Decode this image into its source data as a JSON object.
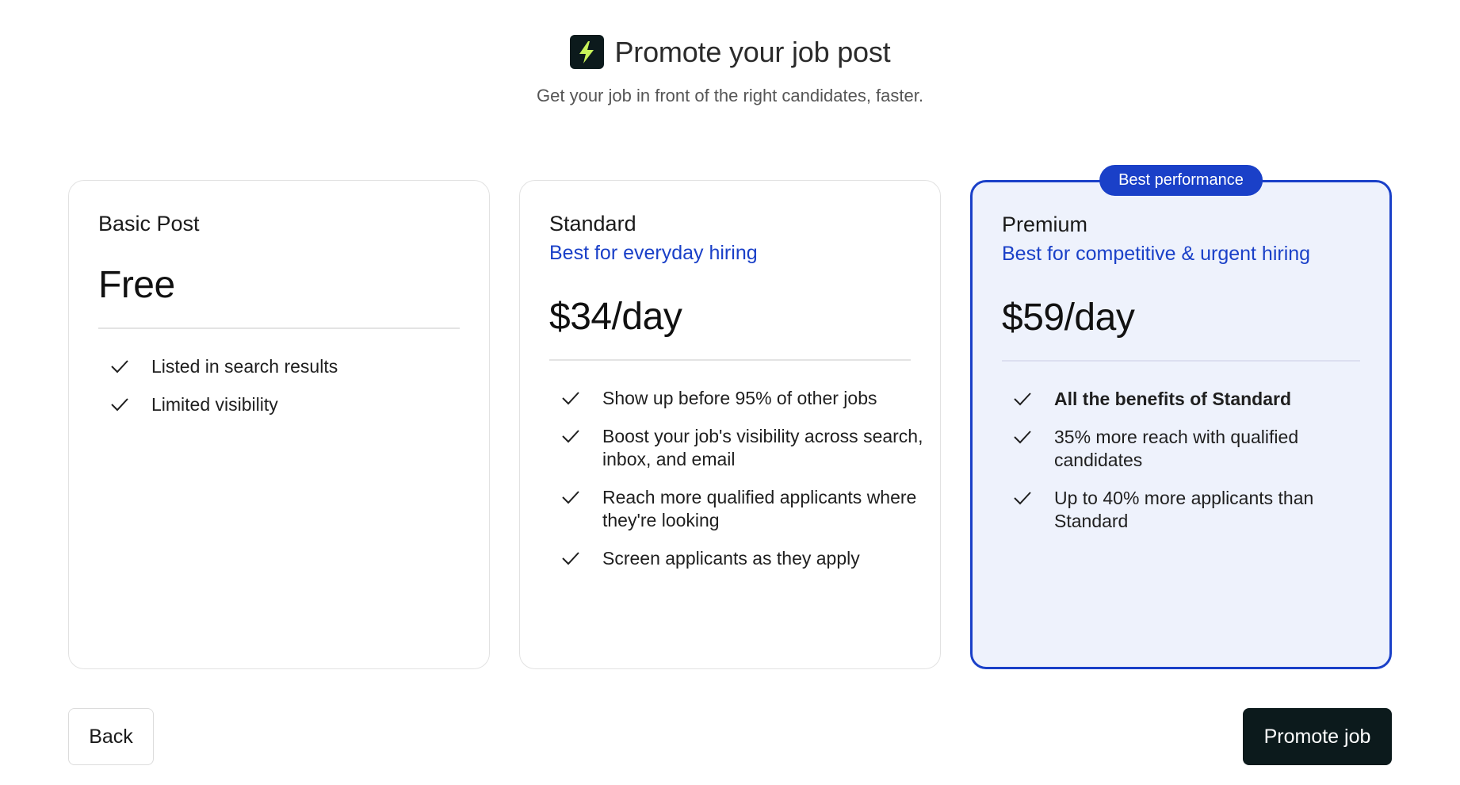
{
  "header": {
    "icon": "lightning-bolt-icon",
    "title": "Promote your job post",
    "subtitle": "Get your job in front of the right candidates, faster."
  },
  "plans": [
    {
      "name": "Basic Post",
      "tagline": "",
      "price": "Free",
      "features": [
        "Listed in search results",
        "Limited visibility"
      ]
    },
    {
      "name": "Standard",
      "tagline": "Best for everyday hiring",
      "price": "$34/day",
      "features": [
        "Show up before 95% of other jobs",
        "Boost your job's visibility across search, inbox, and email",
        "Reach more qualified applicants where they're looking",
        "Screen applicants as they apply"
      ]
    },
    {
      "name": "Premium",
      "badge": "Best performance",
      "tagline": "Best for competitive & urgent hiring",
      "price": "$59/day",
      "selected": true,
      "features": [
        "All the benefits of Standard",
        "35% more reach with qualified candidates",
        "Up to 40% more applicants than Standard"
      ]
    }
  ],
  "footer": {
    "back_label": "Back",
    "promote_label": "Promote job"
  },
  "colors": {
    "accent": "#1a40c8",
    "selected_bg": "#eef2fc",
    "dark_button": "#0c1a1c",
    "bolt": "#c8f25a"
  }
}
